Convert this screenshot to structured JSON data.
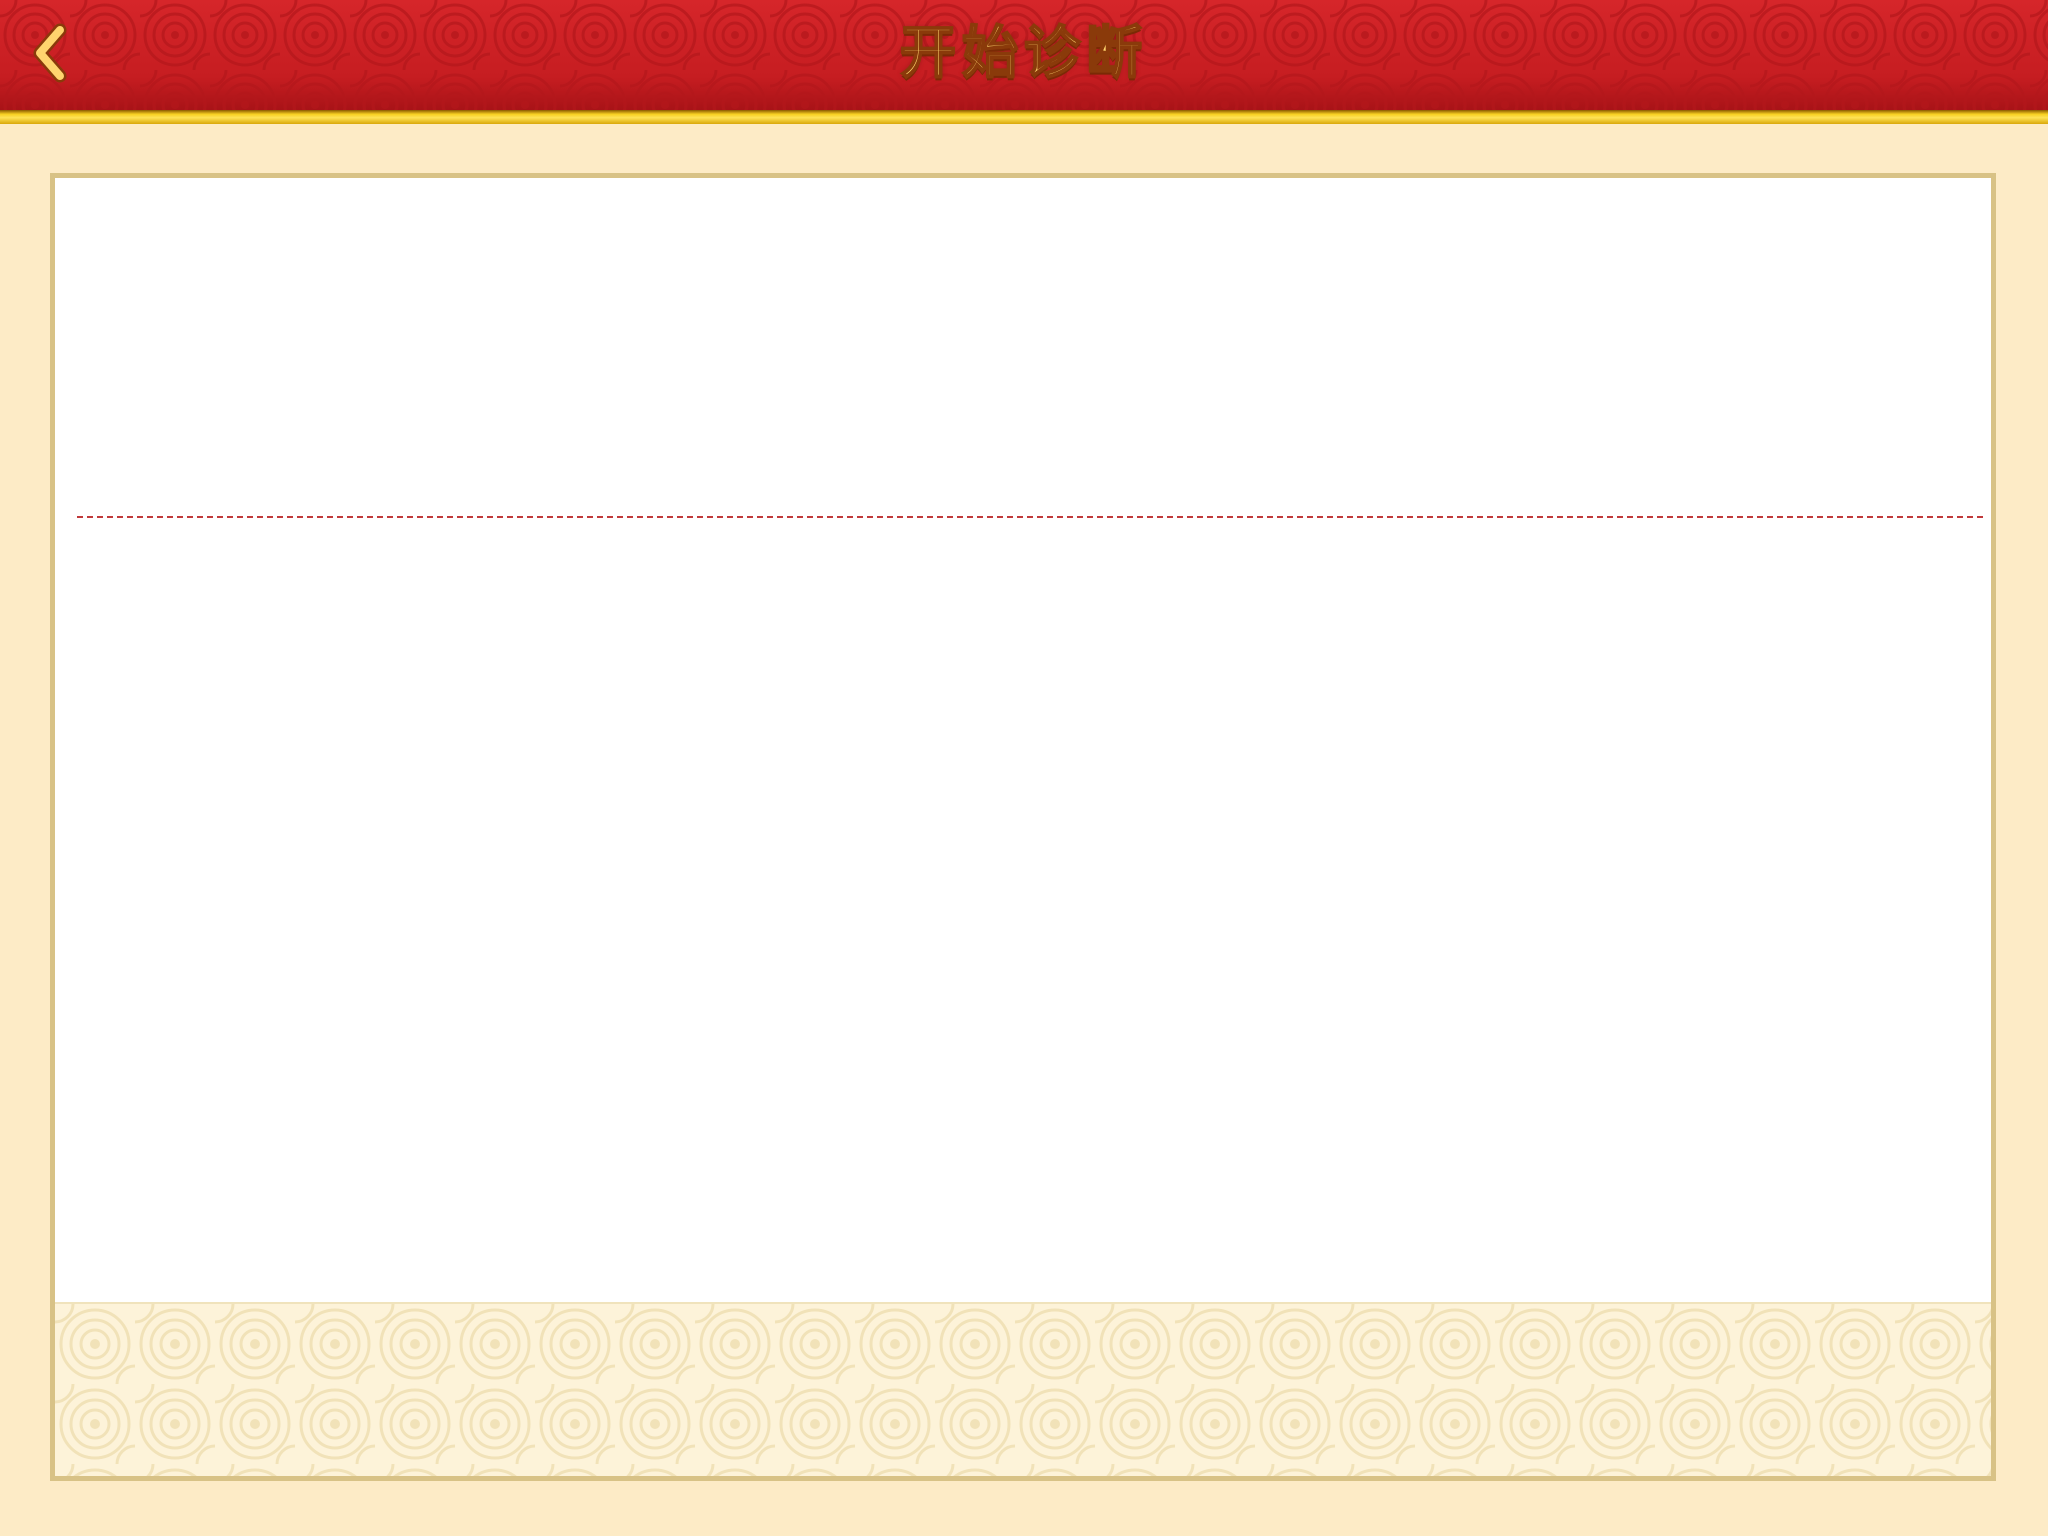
{
  "header": {
    "title": "开始诊断",
    "back_icon": "chevron-left-icon"
  },
  "colors": {
    "header_red": "#c61d21",
    "trim_gold": "#f7d021",
    "page_background": "#fdebc6",
    "panel_border": "#d8c286",
    "divider": "#c0393b",
    "footer_background": "#fdf3d9"
  },
  "main": {
    "decoration": "swirl-cloud-pattern"
  }
}
